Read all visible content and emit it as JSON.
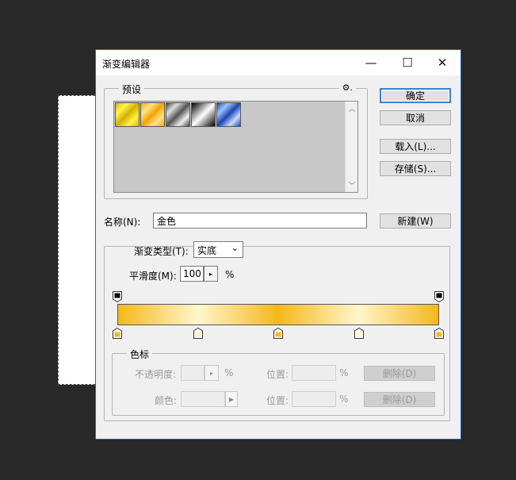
{
  "dialog": {
    "title": "渐变编辑器",
    "minimize_glyph": "—",
    "maximize_glyph": "☐",
    "close_glyph": "✕"
  },
  "presets": {
    "legend": "预设",
    "gear_glyph": "⚙.",
    "swatches": [
      {
        "name": "yellow-violet-yellow",
        "colors": [
          "#d9b800",
          "#fff34a",
          "#d4b000",
          "#fff34a",
          "#d9b800"
        ]
      },
      {
        "name": "orange-yellow-orange",
        "colors": [
          "#f7a800",
          "#ffe48a",
          "#f5a300",
          "#ffe48a",
          "#f7a800"
        ]
      },
      {
        "name": "steel-bars",
        "colors": [
          "#444",
          "#ddd",
          "#555",
          "#eee",
          "#444"
        ]
      },
      {
        "name": "black-white",
        "colors": [
          "#000",
          "#fff",
          "#000"
        ]
      },
      {
        "name": "blue-bars",
        "colors": [
          "#1c46b0",
          "#9fc2ff",
          "#1c46b0",
          "#c8dcff",
          "#1c46b0"
        ]
      }
    ],
    "scroll_up_glyph": "︿",
    "scroll_down_glyph": "﹀"
  },
  "buttons": {
    "ok": "确定",
    "cancel": "取消",
    "load": "载入(L)...",
    "save": "存储(S)...",
    "new": "新建(W)"
  },
  "name": {
    "label": "名称(N):",
    "value": "金色"
  },
  "gradient": {
    "type_label": "渐变类型(T):",
    "type_value": "实底",
    "smoothness_label": "平滑度(M):",
    "smoothness_value": "100",
    "percent": "%",
    "stepper_glyph": "▸",
    "colors": [
      "#f4b81c",
      "#fff6cc",
      "#f4b81c",
      "#fff6cc",
      "#f4b81c"
    ],
    "opacity_stops": [
      0,
      100
    ],
    "color_stops": [
      {
        "position": 0,
        "color": "#f4b81c"
      },
      {
        "position": 25,
        "color": "#fff6cc"
      },
      {
        "position": 50,
        "color": "#f4b81c"
      },
      {
        "position": 75,
        "color": "#fff6cc"
      },
      {
        "position": 100,
        "color": "#f4b81c"
      }
    ]
  },
  "stops_panel": {
    "legend": "色标",
    "opacity_label": "不透明度:",
    "percent": "%",
    "location_label": "位置:",
    "delete_label": "删除(D)",
    "color_label": "颜色:",
    "stepper_glyph": "▸",
    "color_arrow_glyph": "▶"
  }
}
